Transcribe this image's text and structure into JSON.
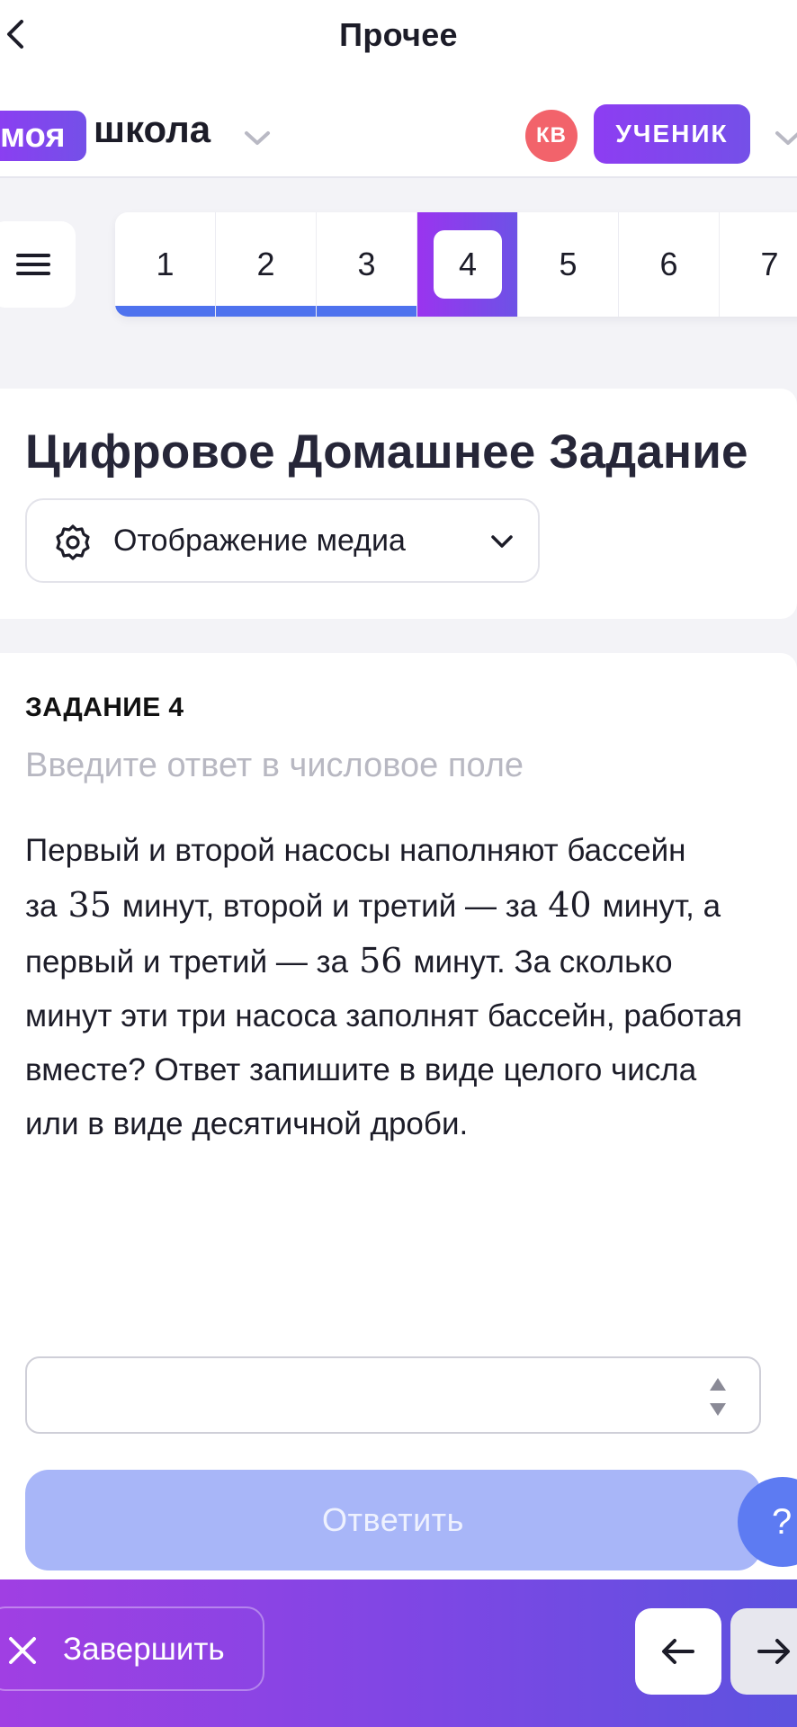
{
  "topbar": {
    "title": "Прочее"
  },
  "header": {
    "logo_badge": "моя",
    "logo_text": "школа",
    "avatar_initials": "КВ",
    "role": "УЧЕНИК"
  },
  "task_nav": {
    "items": [
      {
        "label": "1",
        "state": "answered"
      },
      {
        "label": "2",
        "state": "answered"
      },
      {
        "label": "3",
        "state": "answered"
      },
      {
        "label": "4",
        "state": "active"
      },
      {
        "label": "5",
        "state": "pending"
      },
      {
        "label": "6",
        "state": "pending"
      },
      {
        "label": "7",
        "state": "pending"
      }
    ]
  },
  "title_card": {
    "title": "Цифровое Домашнее Задание",
    "media_select_label": "Отображение медиа"
  },
  "task": {
    "label": "ЗАДАНИЕ 4",
    "hint": "Введите ответ в числовое поле",
    "text_1": "Первый и второй насосы наполняют бассейн за",
    "num_1": "35",
    "text_2": "минут, второй и третий — за",
    "num_2": "40",
    "text_3": "минут, а первый и третий — за",
    "num_3": "56",
    "text_4": "минут. За сколько минут эти три насоса заполнят бассейн, работая вместе?  Ответ запишите в виде целого числа или в виде десятичной дроби.",
    "answer_value": "",
    "submit_label": "Ответить",
    "help_label": "?"
  },
  "bottom": {
    "finish_label": "Завершить"
  },
  "colors": {
    "accent_purple": "#8d3df2",
    "accent_blue": "#4e72ee",
    "submit_disabled": "#a8b6f8",
    "avatar_red": "#f2636b"
  }
}
